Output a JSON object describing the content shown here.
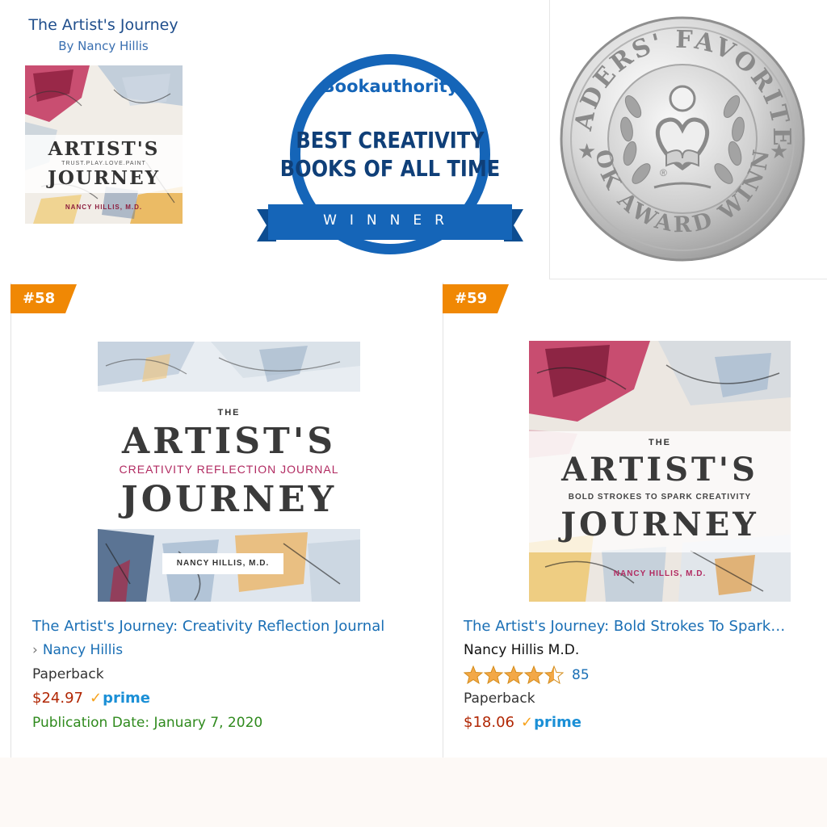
{
  "promo": {
    "title": "The Artist's Journey",
    "author": "By Nancy Hillis",
    "small_cover": {
      "line1": "ARTIST'S",
      "tagline": "TRUST.PLAY.LOVE.PAINT",
      "line2": "JOURNEY",
      "author": "NANCY HILLIS, M.D."
    }
  },
  "bookauthority_badge": {
    "brand": "Bookauthority",
    "line1": "BEST CREATIVITY",
    "line2": "BOOKS OF ALL TIME",
    "ribbon": "WINNER",
    "color": "#1565b8"
  },
  "readers_favorite_badge": {
    "top_text": "READERS' FAVORITE®",
    "bottom_text": "BOOK AWARD WINNER",
    "reg_mark": "®"
  },
  "products": [
    {
      "rank": "#58",
      "cover": {
        "the": "THE",
        "line1": "ARTIST'S",
        "subtitle": "CREATIVITY REFLECTION JOURNAL",
        "line2": "JOURNEY",
        "author": "NANCY HILLIS, M.D."
      },
      "title": "The Artist's Journey: Creativity Reflection Journal",
      "chevron": "›",
      "author": "Nancy Hillis",
      "format": "Paperback",
      "price": "$24.97",
      "prime": "prime",
      "pub_date": "Publication Date: January 7, 2020"
    },
    {
      "rank": "#59",
      "cover": {
        "the": "THE",
        "line1": "ARTIST'S",
        "subtitle": "BOLD STROKES TO SPARK CREATIVITY",
        "line2": "JOURNEY",
        "author": "NANCY HILLIS, M.D."
      },
      "title": "The Artist's Journey: Bold Strokes To Spark…",
      "author": "Nancy Hillis M.D.",
      "rating_stars": 4.5,
      "rating_count": "85",
      "format": "Paperback",
      "price": "$18.06",
      "prime": "prime"
    }
  ],
  "colors": {
    "rank_badge": "#f08804",
    "link": "#1a6fb5",
    "price": "#b12704",
    "pub_date": "#2f8a1d",
    "star": "#f3a847"
  }
}
